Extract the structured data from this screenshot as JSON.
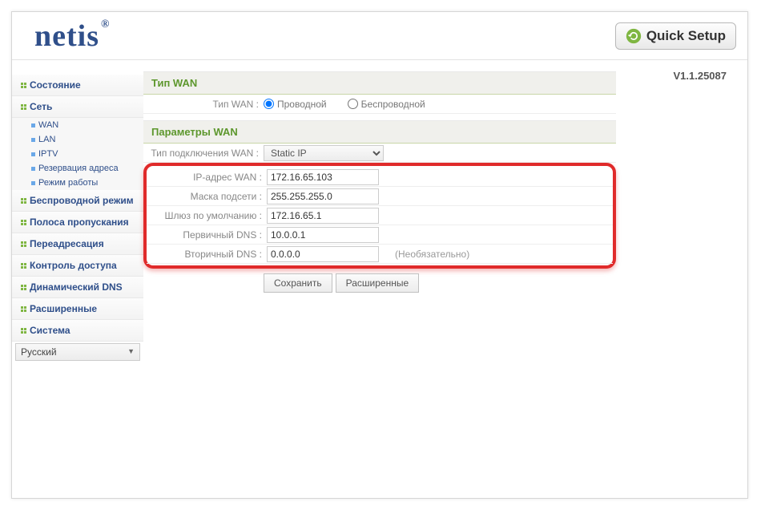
{
  "brand": "netis",
  "quick_setup_label": "Quick Setup",
  "version": "V1.1.25087",
  "language_selected": "Русский",
  "sidebar": {
    "groups": [
      {
        "label": "Состояние"
      },
      {
        "label": "Сеть",
        "expanded": true,
        "items": [
          "WAN",
          "LAN",
          "IPTV",
          "Резервация адреса",
          "Режим работы"
        ]
      },
      {
        "label": "Беспроводной режим"
      },
      {
        "label": "Полоса пропускания"
      },
      {
        "label": "Переадресация"
      },
      {
        "label": "Контроль доступа"
      },
      {
        "label": "Динамический DNS"
      },
      {
        "label": "Расширенные"
      },
      {
        "label": "Система"
      }
    ]
  },
  "sections": {
    "wan_type": {
      "title": "Тип WAN",
      "label": "Тип WAN :",
      "options": {
        "wired": "Проводной",
        "wireless": "Беспроводной"
      },
      "selected": "wired"
    },
    "wan_params": {
      "title": "Параметры WAN",
      "conn_type_label": "Тип подключения WAN :",
      "conn_type_value": "Static IP",
      "fields": {
        "ip": {
          "label": "IP-адрес WAN :",
          "value": "172.16.65.103"
        },
        "mask": {
          "label": "Маска подсети :",
          "value": "255.255.255.0"
        },
        "gw": {
          "label": "Шлюз по умолчанию :",
          "value": "172.16.65.1"
        },
        "dns1": {
          "label": "Первичный DNS :",
          "value": "10.0.0.1"
        },
        "dns2": {
          "label": "Вторичный DNS :",
          "value": "0.0.0.0",
          "note": "(Необязательно)"
        }
      }
    }
  },
  "buttons": {
    "save": "Сохранить",
    "advanced": "Расширенные"
  }
}
